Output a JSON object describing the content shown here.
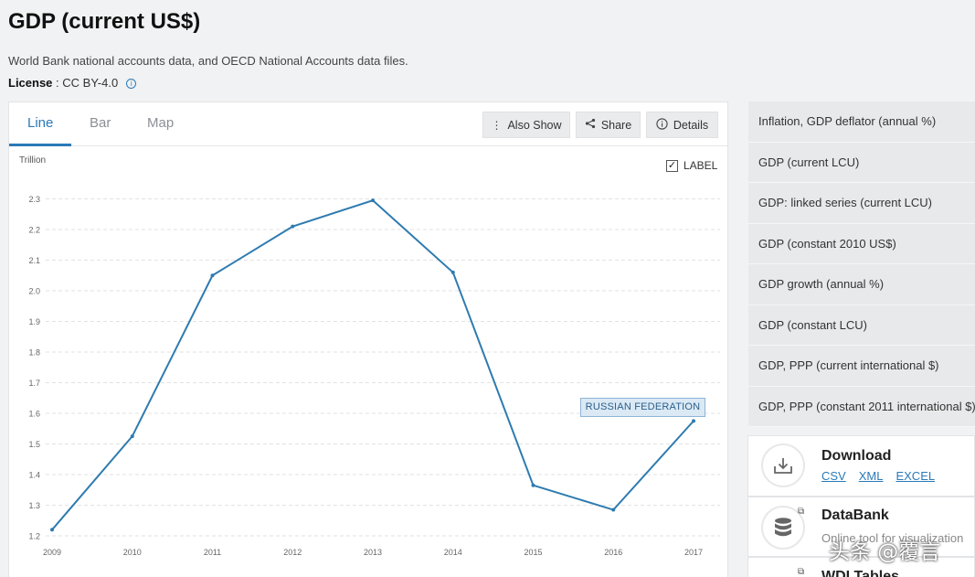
{
  "page": {
    "title": "GDP (current US$)",
    "subtitle": "World Bank national accounts data, and OECD National Accounts data files.",
    "license_label": "License",
    "license_value": " : CC BY-4.0"
  },
  "tabs": [
    {
      "label": "Line",
      "active": true
    },
    {
      "label": "Bar",
      "active": false
    },
    {
      "label": "Map",
      "active": false
    }
  ],
  "toolbar": {
    "also_show": "Also Show",
    "share": "Share",
    "details": "Details"
  },
  "label_toggle": {
    "text": "LABEL",
    "checked": true
  },
  "chart_data": {
    "type": "line",
    "ylabel": "Trillion",
    "x": [
      "2009",
      "2010",
      "2011",
      "2012",
      "2013",
      "2014",
      "2015",
      "2016",
      "2017"
    ],
    "yticks": [
      "1.2",
      "1.3",
      "1.4",
      "1.5",
      "1.6",
      "1.7",
      "1.8",
      "1.9",
      "2.0",
      "2.1",
      "2.2",
      "2.3"
    ],
    "ylim": [
      1.2,
      2.35
    ],
    "grid": true,
    "series": [
      {
        "name": "RUSSIAN FEDERATION",
        "color": "#2e7bb0",
        "values": [
          1.22,
          1.525,
          2.05,
          2.21,
          2.295,
          2.06,
          1.365,
          1.285,
          1.575
        ]
      }
    ]
  },
  "sidebar": {
    "items": [
      "Inflation, GDP deflator (annual %)",
      "GDP (current LCU)",
      "GDP: linked series (current LCU)",
      "GDP (constant 2010 US$)",
      "GDP growth (annual %)",
      "GDP (constant LCU)",
      "GDP, PPP (current international $)",
      "GDP, PPP (constant 2011 international $)"
    ]
  },
  "download": {
    "title": "Download",
    "links": [
      "CSV",
      "XML",
      "EXCEL"
    ]
  },
  "databank": {
    "title": "DataBank",
    "desc": "Online tool for visualization"
  },
  "wdi": {
    "title": "WDI Tables"
  },
  "watermark": "头条 @覆言",
  "colors": {
    "accent": "#2a7ab8",
    "line": "#2e7bb0"
  }
}
